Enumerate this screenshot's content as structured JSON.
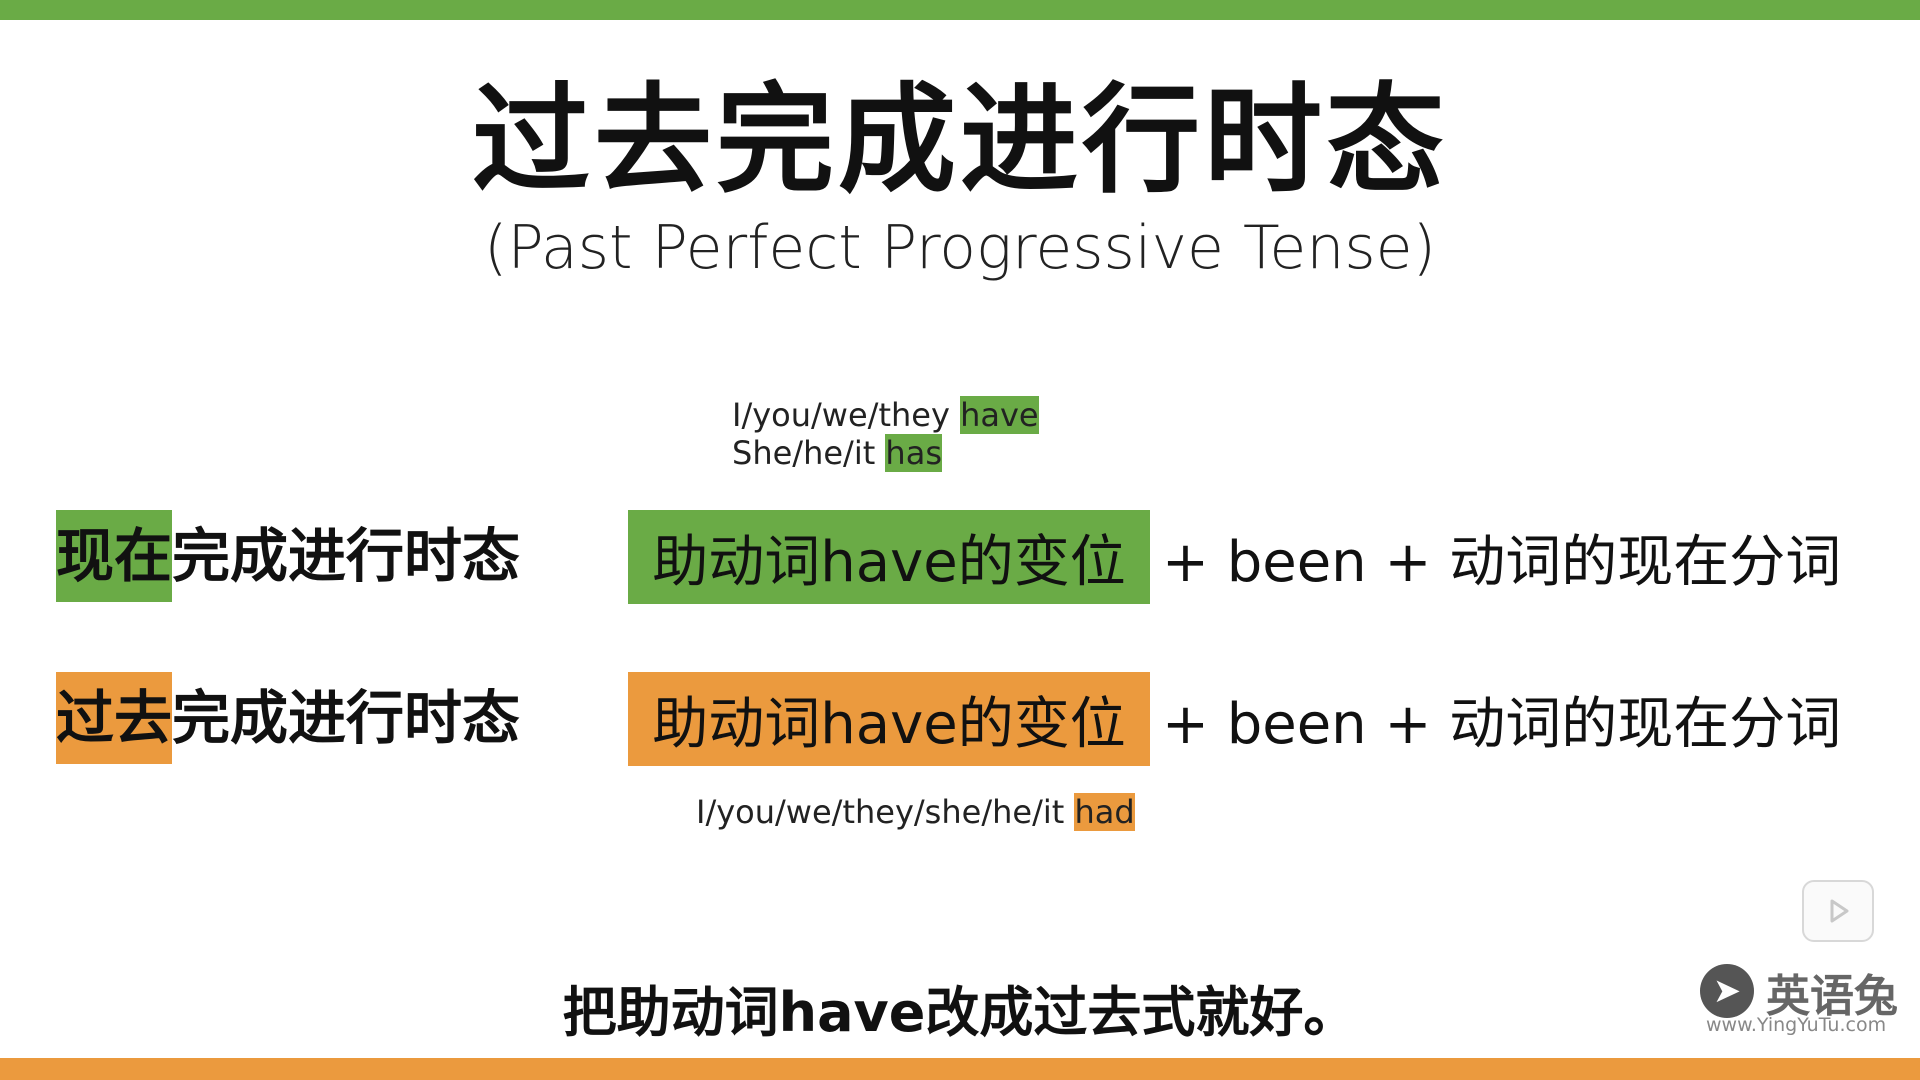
{
  "title": "过去完成进行时态",
  "subtitle": "(Past Perfect Progressive Tense)",
  "colors": {
    "green": "#6aab46",
    "orange": "#eb9a3e"
  },
  "present_hint": {
    "line1_prefix": "I/you/we/they ",
    "line1_highlight": "have",
    "line2_prefix": "She/he/it ",
    "line2_highlight": "has"
  },
  "rows": [
    {
      "label_highlight": "现在",
      "label_rest": "完成进行时态",
      "box": "助动词have的变位",
      "rest": "+ been + 动词的现在分词"
    },
    {
      "label_highlight": "过去",
      "label_rest": "完成进行时态",
      "box": "助动词have的变位",
      "rest": "+ been + 动词的现在分词"
    }
  ],
  "past_hint": {
    "prefix": "I/you/we/they/she/he/it ",
    "highlight": "had"
  },
  "caption": "把助动词have改成过去式就好。",
  "logo": {
    "name": "英语兔",
    "url": "www.YingYuTu.com"
  }
}
